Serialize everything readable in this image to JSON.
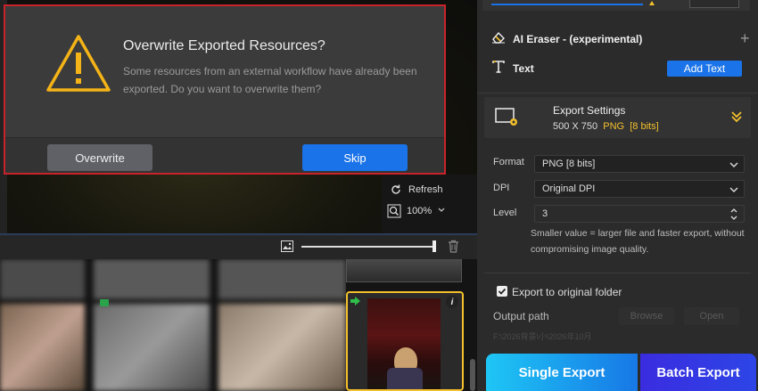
{
  "dialog": {
    "title": "Overwrite Exported Resources?",
    "message": "Some resources from an external workflow have already been exported. Do you want to overwrite them?",
    "overwrite_label": "Overwrite",
    "skip_label": "Skip"
  },
  "preview": {
    "refresh_label": "Refresh",
    "zoom_label": "100%"
  },
  "tools": {
    "ai_eraser_label": "AI Eraser - (experimental)",
    "text_label": "Text",
    "add_text_label": "Add Text"
  },
  "export_settings": {
    "title": "Export Settings",
    "size": "500 X 750",
    "format_short": "PNG",
    "bits": "[8 bits]",
    "format_label": "Format",
    "format_value": "PNG  [8 bits]",
    "dpi_label": "DPI",
    "dpi_value": "Original DPI",
    "level_label": "Level",
    "level_value": "3",
    "hint": "Smaller value = larger file and faster export, without compromising image quality.",
    "export_to_original_label": "Export to original folder",
    "export_to_original_checked": true,
    "output_path_label": "Output path",
    "browse_label": "Browse",
    "open_label": "Open",
    "output_path_value": "F:\\2026背景\\小\\2026年10月"
  },
  "actions": {
    "single_export_label": "Single Export",
    "batch_export_label": "Batch Export"
  },
  "colors": {
    "accent_blue": "#1a73e8",
    "selection_yellow": "#f4c02c",
    "dialog_border_red": "#c8232a"
  }
}
